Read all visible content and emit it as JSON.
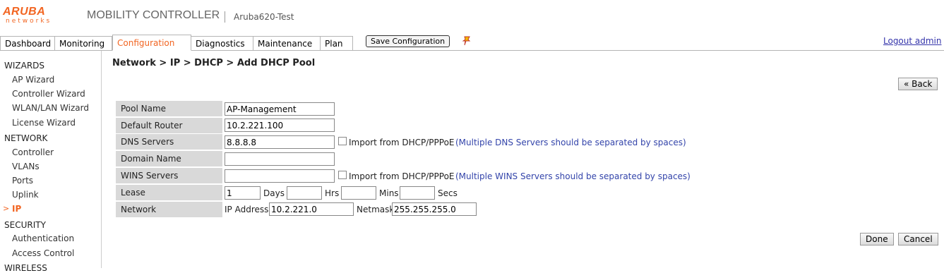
{
  "header": {
    "logo_main": "ARUBA",
    "logo_sub": "networks",
    "product": "MOBILITY CONTROLLER",
    "device": "Aruba620-Test"
  },
  "tabs": [
    {
      "label": "Dashboard",
      "active": false
    },
    {
      "label": "Monitoring",
      "active": false
    },
    {
      "label": "Configuration",
      "active": true
    },
    {
      "label": "Diagnostics",
      "active": false
    },
    {
      "label": "Maintenance",
      "active": false
    },
    {
      "label": "Plan",
      "active": false
    }
  ],
  "toolbar": {
    "save_label": "Save Configuration",
    "logout_label": "Logout admin"
  },
  "sidebar": {
    "wizards": {
      "title": "WIZARDS",
      "items": [
        "AP Wizard",
        "Controller Wizard",
        "WLAN/LAN Wizard",
        "License Wizard"
      ]
    },
    "network": {
      "title": "NETWORK",
      "items": [
        "Controller",
        "VLANs",
        "Ports",
        "Uplink",
        "IP"
      ],
      "active": "IP"
    },
    "security": {
      "title": "SECURITY",
      "items": [
        "Authentication",
        "Access Control"
      ]
    },
    "wireless": {
      "title": "WIRELESS"
    },
    "active_marker": ">"
  },
  "main": {
    "breadcrumb": "Network > IP > DHCP > Add DHCP Pool",
    "back_label": "« Back",
    "done_label": "Done",
    "cancel_label": "Cancel"
  },
  "form": {
    "pool_name": {
      "label": "Pool Name",
      "value": "AP-Management"
    },
    "default_router": {
      "label": "Default Router",
      "value": "10.2.221.100"
    },
    "dns_servers": {
      "label": "DNS Servers",
      "value": "8.8.8.8",
      "import_label": "Import from DHCP/PPPoE",
      "hint": "(Multiple DNS Servers should be separated by spaces)"
    },
    "domain_name": {
      "label": "Domain Name",
      "value": ""
    },
    "wins_servers": {
      "label": "WINS Servers",
      "value": "",
      "import_label": "Import from DHCP/PPPoE",
      "hint": "(Multiple WINS Servers should be separated by spaces)"
    },
    "lease": {
      "label": "Lease",
      "days_value": "1",
      "days_label": "Days",
      "hrs_value": "",
      "hrs_label": "Hrs",
      "mins_value": "",
      "mins_label": "Mins",
      "secs_value": "",
      "secs_label": "Secs"
    },
    "network": {
      "label": "Network",
      "ip_label": "IP Address",
      "ip_value": "10.2.221.0",
      "mask_label": "Netmask",
      "mask_value": "255.255.255.0"
    }
  },
  "colors": {
    "accent": "#f26522",
    "link": "#3344aa",
    "label_bg": "#d9d9d9"
  }
}
